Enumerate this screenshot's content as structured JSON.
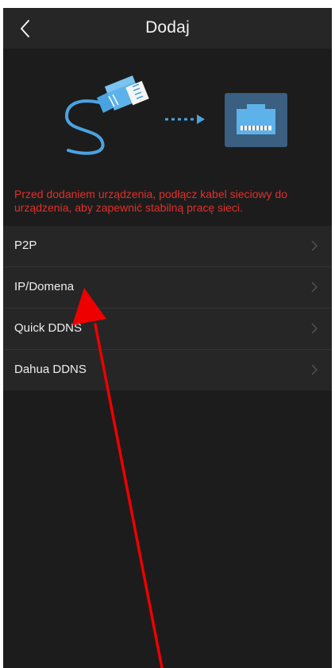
{
  "header": {
    "title": "Dodaj",
    "back_icon": "chevron-left-icon"
  },
  "illustration": {
    "cable_icon": "ethernet-cable-icon",
    "arrow_icon": "dashed-arrow-right-icon",
    "port_icon": "ethernet-port-icon",
    "accent_color": "#4aa3e0"
  },
  "notice": {
    "text": "Przed dodaniem urządzenia, podłącz kabel sieciowy do urządzenia, aby zapewnić stabilną pracę sieci.",
    "color": "#e0302a"
  },
  "menu": {
    "items": [
      {
        "label": "P2P"
      },
      {
        "label": "IP/Domena"
      },
      {
        "label": "Quick DDNS"
      },
      {
        "label": "Dahua DDNS"
      }
    ]
  },
  "annotation": {
    "arrow_icon": "red-pointer-arrow",
    "color": "#ee0000"
  }
}
